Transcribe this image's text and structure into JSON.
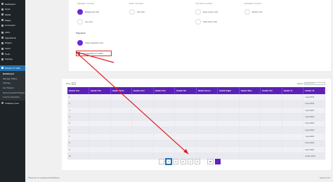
{
  "sidebar": {
    "items": [
      {
        "label": "Dashboard",
        "icon": "dashboard-icon"
      },
      {
        "label": "Posts",
        "icon": "posts-icon"
      },
      {
        "label": "Media",
        "icon": "media-icon"
      },
      {
        "label": "Pages",
        "icon": "pages-icon"
      },
      {
        "label": "Comments",
        "icon": "comments-icon"
      },
      {
        "label": "Astra",
        "icon": "astra-icon"
      },
      {
        "label": "Appearance",
        "icon": "appearance-icon"
      },
      {
        "label": "Plugins",
        "icon": "plugins-icon"
      },
      {
        "label": "Users",
        "icon": "users-icon"
      },
      {
        "label": "Tools",
        "icon": "tools-icon"
      },
      {
        "label": "Settings",
        "icon": "settings-icon"
      }
    ],
    "active": {
      "label": "Ebooks To Table",
      "icon": "table-icon"
    },
    "submenu": [
      "Dashboard",
      "Manage Tables",
      "Settings",
      "Get Started",
      "Recommended Plugins",
      "License Activation"
    ],
    "collapse": "Collapse menu"
  },
  "colors": {
    "columns": [
      {
        "title": "HEADER COLORS",
        "rows": [
          {
            "label": "Background color",
            "color": "#6d28d9"
          },
          {
            "label": "Text color",
            "color": "#ffffff"
          }
        ]
      },
      {
        "title": "BODY COLORS",
        "rows": [
          {
            "label": "Text color",
            "color": "#ffffff"
          }
        ]
      },
      {
        "title": "COLUMN COLORS",
        "rows": [
          {
            "label": "Even column color",
            "color": "#ffffff"
          },
          {
            "label": "Odd column color",
            "color": "#ffffff"
          }
        ]
      },
      {
        "title": "BORDER COLORS",
        "rows": [
          {
            "label": "Border Color",
            "color": "#ffffff"
          }
        ]
      }
    ]
  },
  "pagination_section": {
    "heading": "Pagination",
    "active_color_label": "Active pagination color",
    "active_color": "#6d28d9",
    "hide_label": "Hide pagination on mobile"
  },
  "table": {
    "show_label": "Show",
    "entries_value": "10",
    "search_label": "Search:",
    "search_placeholder": "Search here",
    "headers": [
      "Header One",
      "Header Two",
      "Header Three",
      "Header Four",
      "Header Five",
      "Header Six",
      "Header Seven",
      "Header Eight",
      "Header Nine",
      "Header Ten",
      "Header 11",
      "Header 12"
    ],
    "rows": [
      [
        "1",
        "",
        "",
        "",
        "",
        "",
        "",
        "",
        "",
        "",
        "",
        "1-jan-2024"
      ],
      [
        "2",
        "",
        "",
        "",
        "",
        "",
        "",
        "",
        "",
        "",
        "",
        "2-jan-2024"
      ],
      [
        "3",
        "",
        "",
        "",
        "",
        "",
        "",
        "",
        "",
        "",
        "",
        "3-jan-2024"
      ],
      [
        "4",
        "",
        "",
        "",
        "",
        "",
        "",
        "",
        "",
        "",
        "",
        "4-jan-2024"
      ],
      [
        "5",
        "",
        "",
        "",
        "",
        "",
        "",
        "",
        "",
        "",
        "",
        "5-jan-2024"
      ],
      [
        "6",
        "",
        "",
        "",
        "",
        "",
        "",
        "",
        "",
        "",
        "",
        "6-jan-2024"
      ],
      [
        "7",
        "",
        "",
        "",
        "",
        "",
        "",
        "",
        "",
        "",
        "",
        "7-jan-2024"
      ],
      [
        "8",
        "",
        "",
        "",
        "",
        "",
        "",
        "",
        "",
        "",
        "",
        "8-jan-2024"
      ],
      [
        "9",
        "",
        "",
        "",
        "",
        "",
        "",
        "",
        "",
        "",
        "",
        "9-jan-2024"
      ],
      [
        "10",
        "",
        "",
        "",
        "",
        "",
        "",
        "",
        "",
        "",
        "",
        "10-jan-2024"
      ]
    ]
  },
  "pager": {
    "prev": "‹",
    "pages": [
      "1",
      "2",
      "3",
      "4",
      "5",
      "..."
    ],
    "last": "20",
    "next": "›",
    "current": "1"
  },
  "footer": {
    "left": "Thank you for creating with WordPress.",
    "right": "Version 6.4.3"
  },
  "annotation": {
    "color": "#e11d24"
  }
}
